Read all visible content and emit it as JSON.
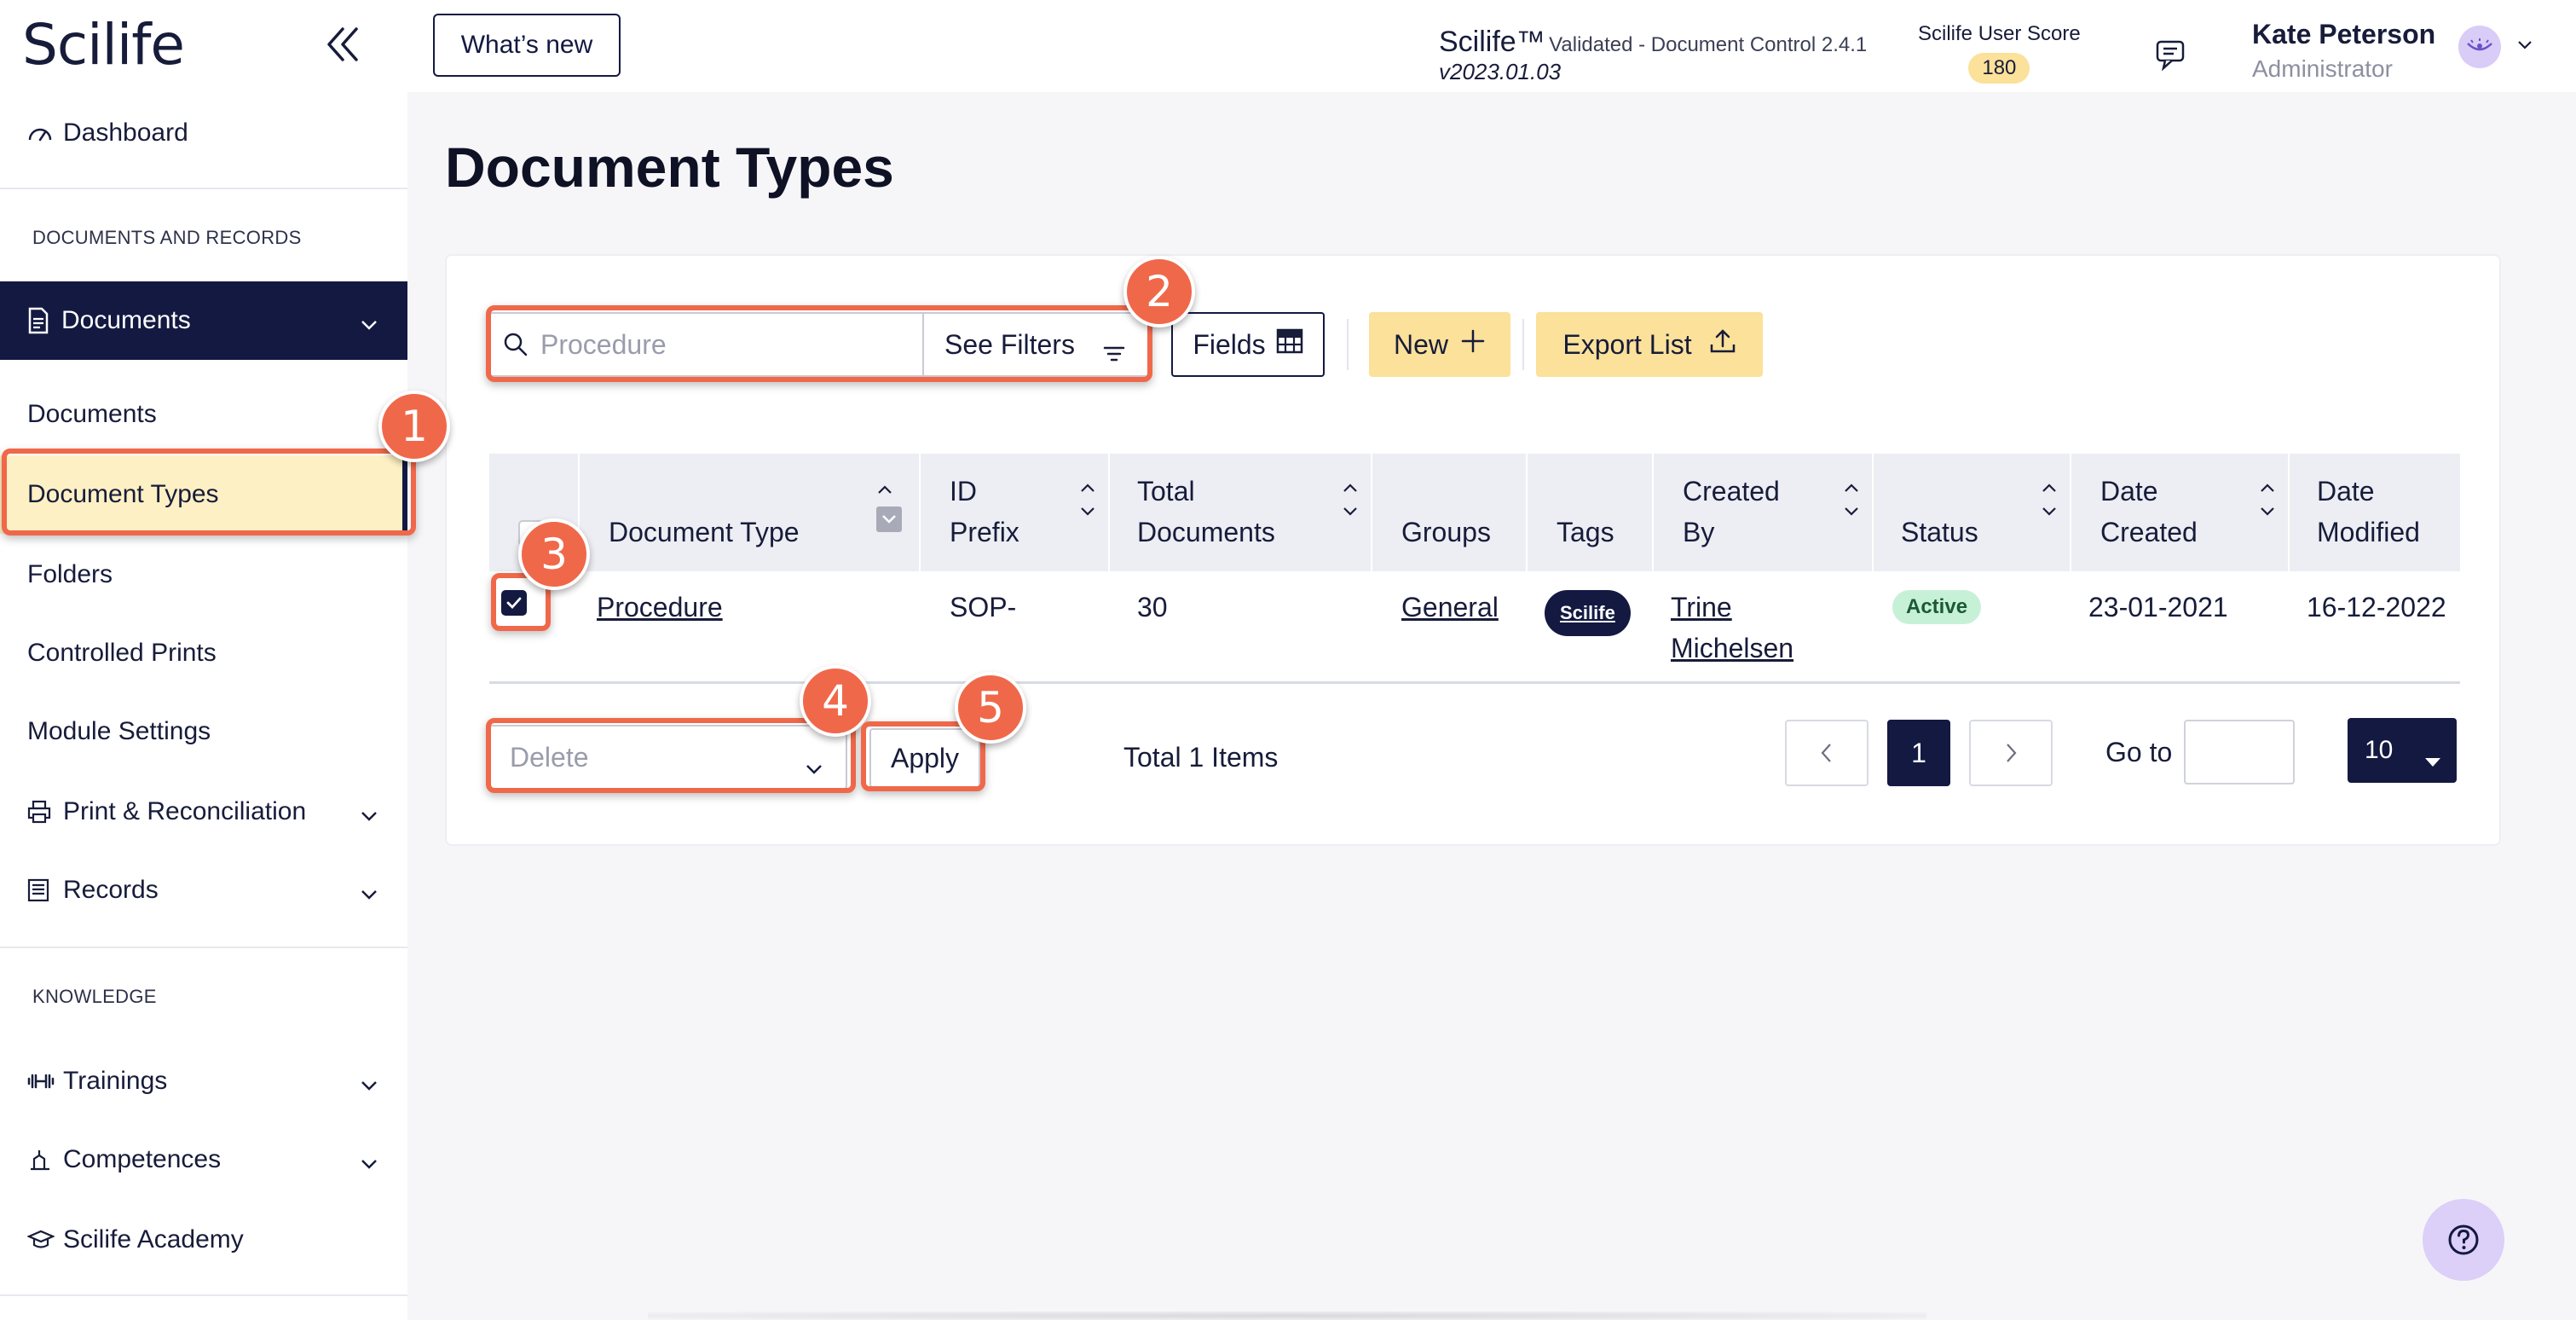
{
  "app": {
    "logo": "Scilife",
    "whats_new": "What’s new",
    "product_name": "Scilife™",
    "product_sub": "Validated - Document Control 2.4.1",
    "product_version": "v2023.01.03",
    "score_title": "Scilife User Score",
    "score_value": "180",
    "user_name": "Kate Peterson",
    "user_role": "Administrator"
  },
  "sidebar": {
    "dashboard": "Dashboard",
    "section_docs": "DOCUMENTS AND RECORDS",
    "documents_group": "Documents",
    "sub_items": [
      "Documents",
      "Document Types",
      "Folders",
      "Controlled Prints",
      "Module Settings"
    ],
    "print_reconciliation": "Print & Reconciliation",
    "records": "Records",
    "section_knowledge": "KNOWLEDGE",
    "trainings": "Trainings",
    "competences": "Competences",
    "academy": "Scilife Academy"
  },
  "page": {
    "title": "Document Types"
  },
  "toolbar": {
    "search_placeholder": "Procedure",
    "see_filters": "See Filters",
    "fields": "Fields",
    "new": "New",
    "export_list": "Export List"
  },
  "table": {
    "headers": {
      "document_type": "Document Type",
      "id_prefix_1": "ID",
      "id_prefix_2": "Prefix",
      "total_docs_1": "Total",
      "total_docs_2": "Documents",
      "groups": "Groups",
      "tags": "Tags",
      "created_by_1": "Created",
      "created_by_2": "By",
      "status": "Status",
      "date_created_1": "Date",
      "date_created_2": "Created",
      "date_modified_1": "Date",
      "date_modified_2": "Modified"
    },
    "rows": [
      {
        "document_type": "Procedure",
        "id_prefix": "SOP-",
        "total_documents": "30",
        "groups": "General",
        "tag": "Scilife",
        "created_by_1": "Trine",
        "created_by_2": "Michelsen",
        "status": "Active",
        "date_created": "23-01-2021",
        "date_modified": "16-12-2022"
      }
    ]
  },
  "footer": {
    "bulk_action": "Delete",
    "apply": "Apply",
    "total": "Total 1 Items",
    "current_page": "1",
    "goto": "Go to",
    "page_size": "10"
  },
  "annotations": [
    "1",
    "2",
    "3",
    "4",
    "5"
  ],
  "colors": {
    "navy": "#131941",
    "accent_yellow": "#fbe199",
    "highlight": "#fdf0c4",
    "annotation": "#f0684a",
    "status_green": "#c7f1d7"
  }
}
